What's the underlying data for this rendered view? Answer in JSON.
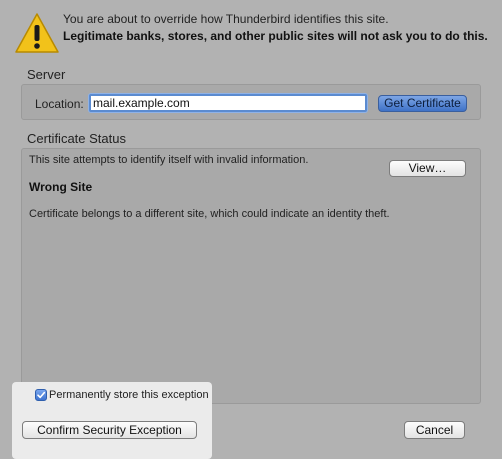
{
  "warning": {
    "line1": "You are about to override how Thunderbird identifies this site.",
    "line2": "Legitimate banks, stores, and other public sites will not ask you to do this.",
    "icon": "warning-triangle"
  },
  "server": {
    "title": "Server",
    "location_label": "Location:",
    "location_value": "mail.example.com",
    "get_certificate_label": "Get Certificate"
  },
  "certificate_status": {
    "title": "Certificate Status",
    "identity_text": "This site attempts to identify itself with invalid information.",
    "view_label": "View…",
    "problem_title": "Wrong Site",
    "problem_text": "Certificate belongs to a different site, which could indicate an identity theft."
  },
  "footer": {
    "store_label": "Permanently store this exception",
    "store_checked": true,
    "confirm_label": "Confirm Security Exception",
    "cancel_label": "Cancel"
  },
  "colors": {
    "dialog_bg": "#b2b2b2",
    "accent": "#3f72c7"
  }
}
